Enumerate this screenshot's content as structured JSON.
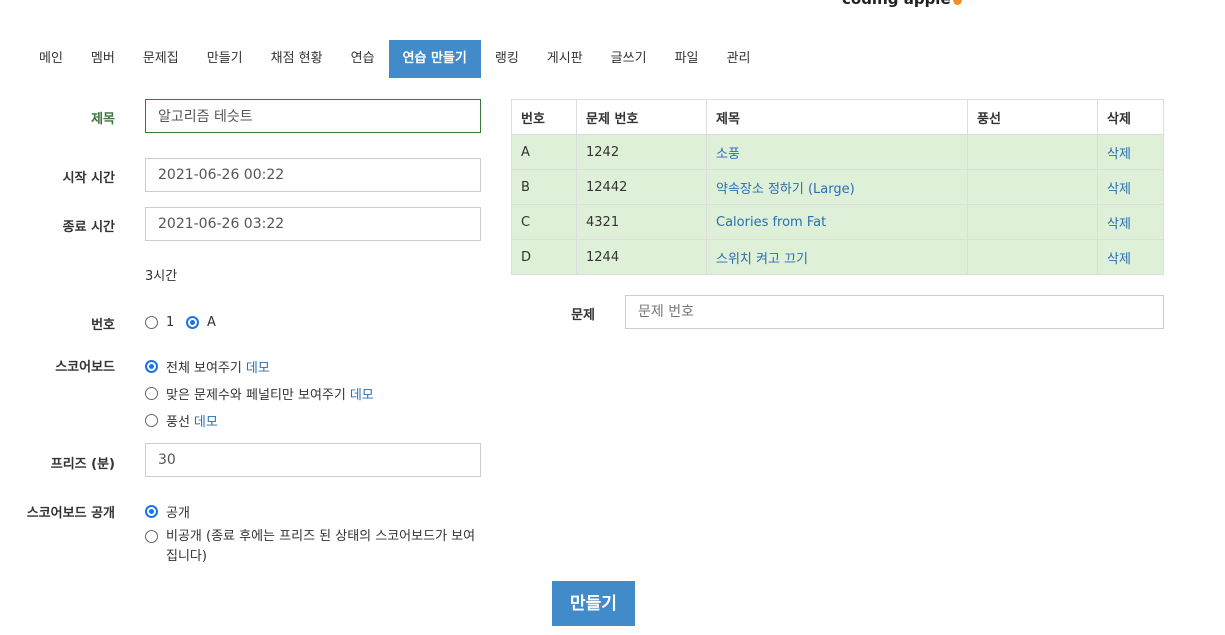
{
  "banner": {
    "text": "",
    "logo": "coding apple"
  },
  "nav": {
    "tabs": [
      {
        "label": "메인"
      },
      {
        "label": "멤버"
      },
      {
        "label": "문제집"
      },
      {
        "label": "만들기"
      },
      {
        "label": "채점 현황"
      },
      {
        "label": "연습"
      },
      {
        "label": "연습 만들기",
        "active": true
      },
      {
        "label": "랭킹"
      },
      {
        "label": "게시판"
      },
      {
        "label": "글쓰기"
      },
      {
        "label": "파일"
      },
      {
        "label": "관리"
      }
    ]
  },
  "form": {
    "title_label": "제목",
    "title_value": "알고리즘 테슷트",
    "start_label": "시작 시간",
    "start_value": "2021-06-26 00:22",
    "end_label": "종료 시간",
    "end_value": "2021-06-26 03:22",
    "duration": "3시간",
    "number_label": "번호",
    "number_options": [
      {
        "label": "1",
        "checked": false
      },
      {
        "label": "A",
        "checked": true
      }
    ],
    "scoreboard_label": "스코어보드",
    "scoreboard_options": [
      {
        "label": "전체 보여주기",
        "demo": "데모",
        "checked": true
      },
      {
        "label": "맞은 문제수와 페널티만 보여주기",
        "demo": "데모",
        "checked": false
      },
      {
        "label": "풍선",
        "demo": "데모",
        "checked": false
      }
    ],
    "freeze_label": "프리즈 (분)",
    "freeze_value": "30",
    "public_label": "스코어보드 공개",
    "public_options": [
      {
        "label": "공개",
        "checked": true
      },
      {
        "label": "비공개 (종료 후에는 프리즈 된 상태의 스코어보드가 보여집니다)",
        "checked": false
      }
    ]
  },
  "problems": {
    "columns": [
      "번호",
      "문제 번호",
      "제목",
      "풍선",
      "삭제"
    ],
    "rows": [
      {
        "letter": "A",
        "id": "1242",
        "title": "소풍",
        "balloon": "",
        "delete": "삭제"
      },
      {
        "letter": "B",
        "id": "12442",
        "title": "약속장소 정하기 (Large)",
        "balloon": "",
        "delete": "삭제"
      },
      {
        "letter": "C",
        "id": "4321",
        "title": "Calories from Fat",
        "balloon": "",
        "delete": "삭제"
      },
      {
        "letter": "D",
        "id": "1244",
        "title": "스위치 켜고 끄기",
        "balloon": "",
        "delete": "삭제"
      }
    ],
    "add_label": "문제",
    "add_placeholder": "문제 번호"
  },
  "submit_label": "만들기",
  "colors": {
    "primary": "#428bca",
    "success_bg": "#dff0d8",
    "success_text": "#3c763d",
    "link": "#2a6fb0"
  }
}
